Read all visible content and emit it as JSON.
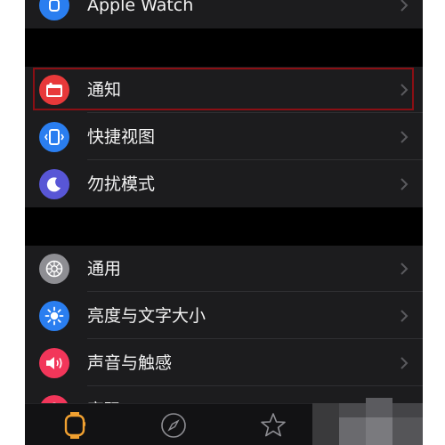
{
  "theme": {
    "background": "#000000",
    "cell": "#1c1c1e",
    "accent_tab": "#f0a030",
    "highlight_border": "#8b0f14"
  },
  "settings": {
    "group1": [
      {
        "label": "Apple Watch",
        "icon": "apple-watch-icon",
        "color": "#2a7ef0"
      }
    ],
    "group2": [
      {
        "label": "通知",
        "icon": "notifications-icon",
        "color": "#e8393a"
      },
      {
        "label": "快捷视图",
        "icon": "glances-icon",
        "color": "#2a7ef0"
      },
      {
        "label": "勿扰模式",
        "icon": "moon-icon",
        "color": "#5856d6"
      }
    ],
    "group3": [
      {
        "label": "通用",
        "icon": "gear-icon",
        "color": "#8e8e93"
      },
      {
        "label": "亮度与文字大小",
        "icon": "brightness-icon",
        "color": "#2a7ef0"
      },
      {
        "label": "声音与触感",
        "icon": "speaker-icon",
        "color": "#f2365a"
      },
      {
        "label": "密码",
        "icon": "lock-icon",
        "color": "#f2365a"
      }
    ]
  },
  "tabbar": {
    "tabs": [
      {
        "name": "my-watch-tab",
        "icon": "watch-icon",
        "active": true
      },
      {
        "name": "explore-tab",
        "icon": "compass-icon",
        "active": false
      },
      {
        "name": "featured-tab",
        "icon": "star-icon",
        "active": false
      }
    ]
  }
}
